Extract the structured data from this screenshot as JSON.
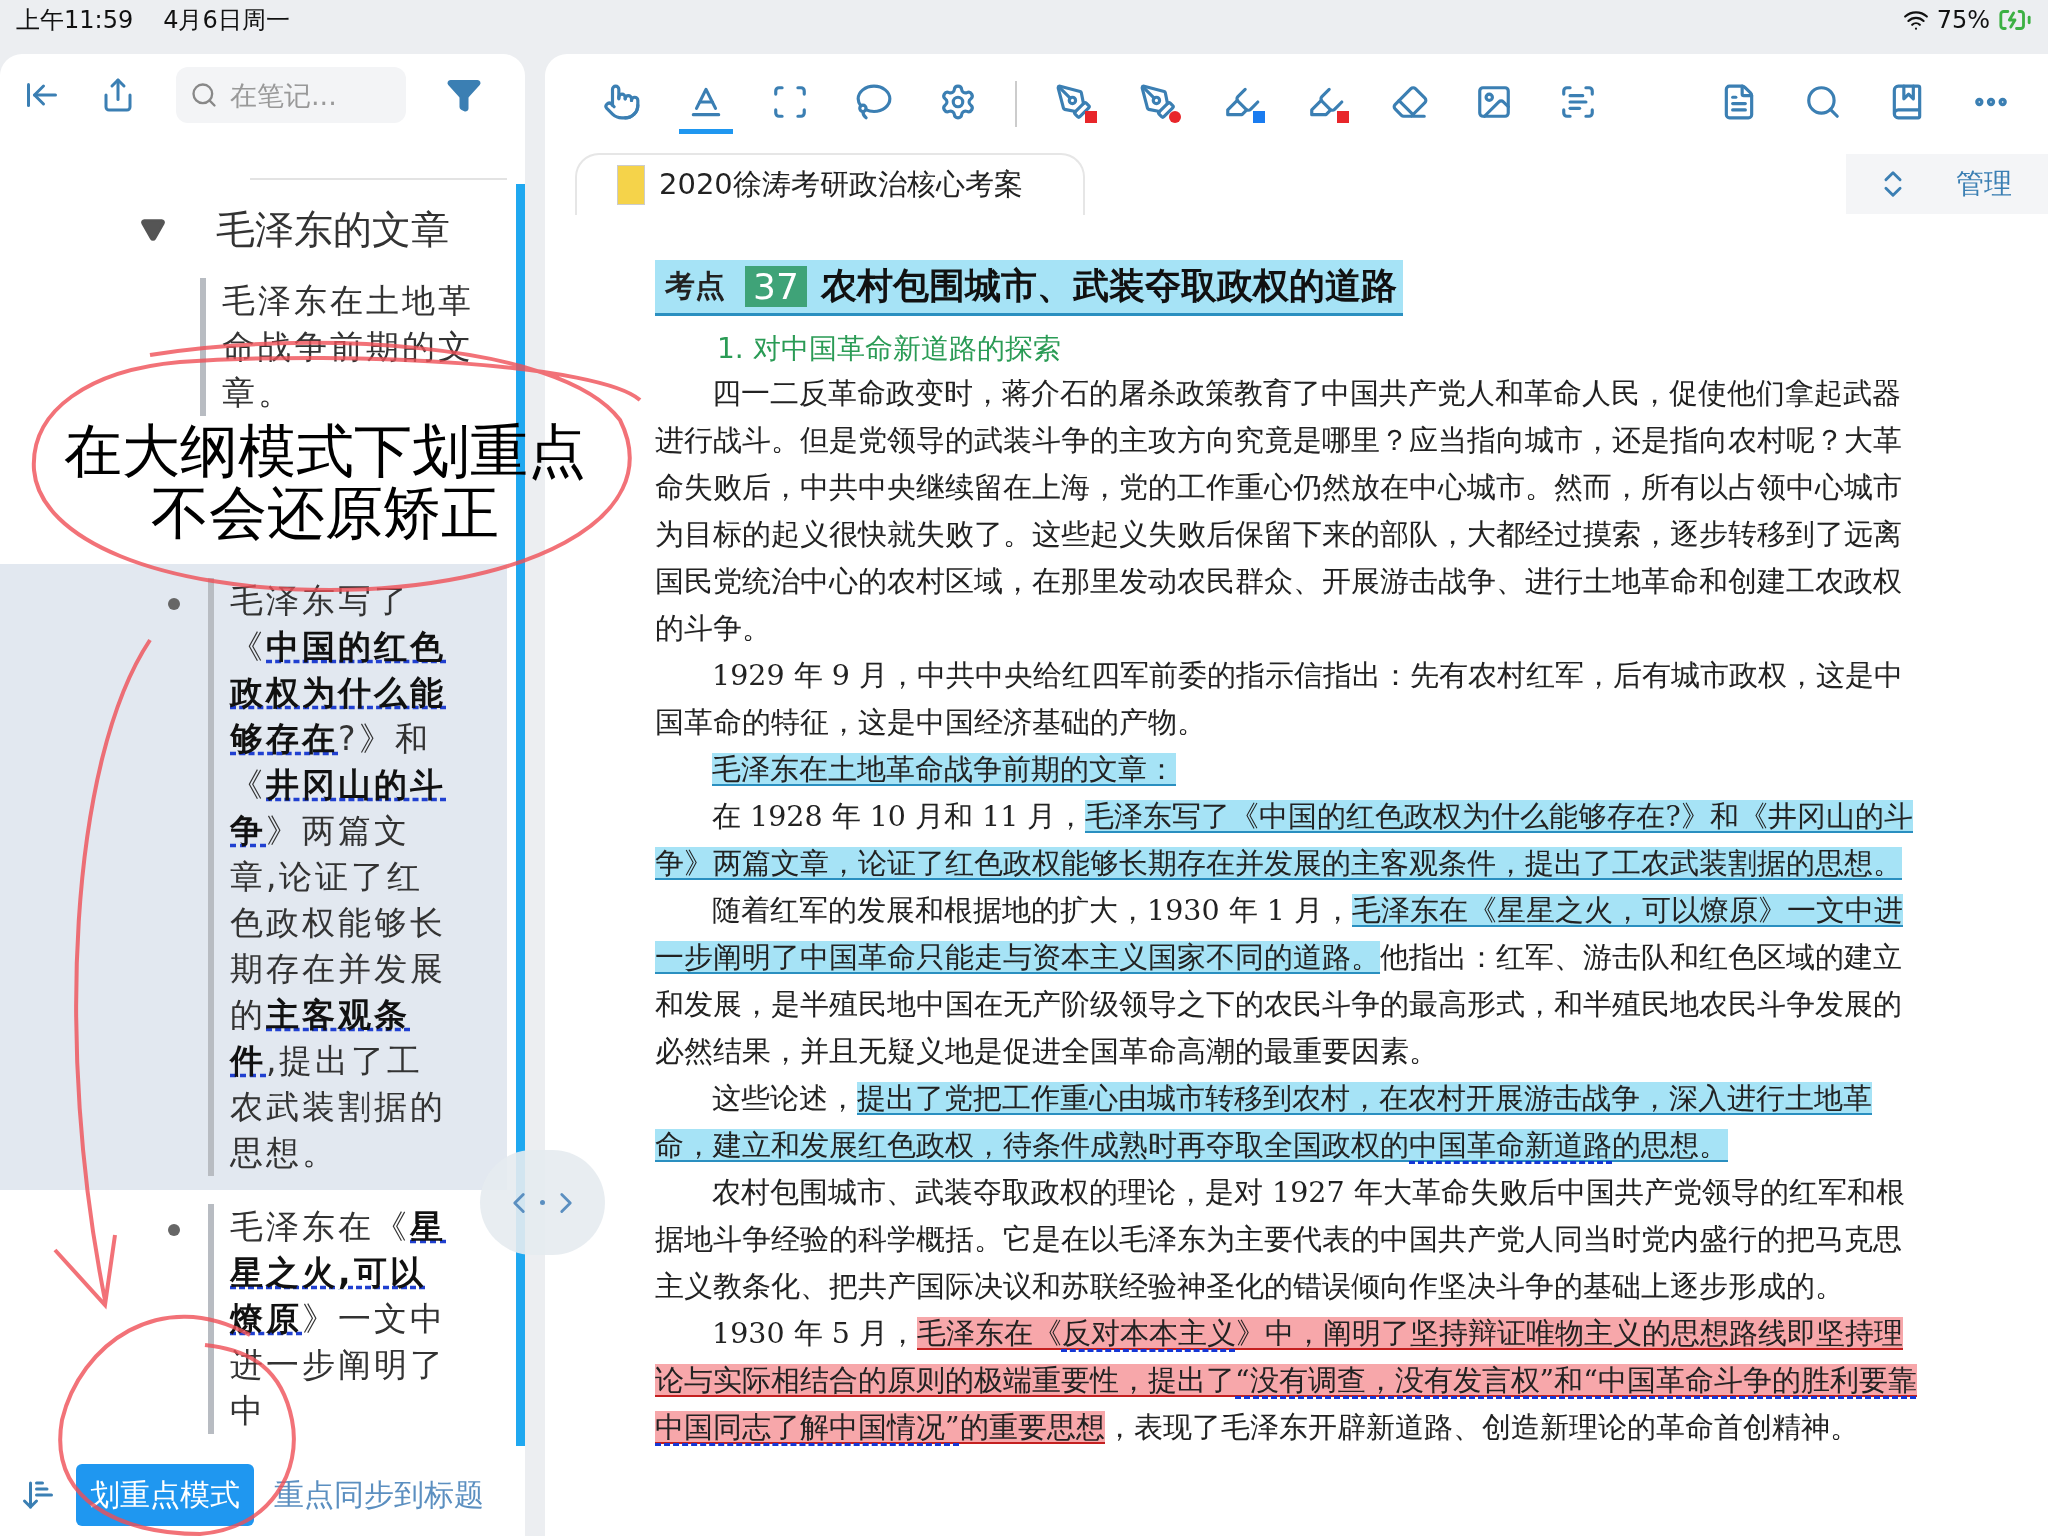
{
  "status_bar": {
    "time": "上午11:59",
    "date": "4月6日周一",
    "battery": "75%"
  },
  "outline_panel": {
    "search": {
      "placeholder": "在笔记..."
    },
    "outline": {
      "title": "毛泽东的文章",
      "expanded": true,
      "children": [
        {
          "text": "毛泽东在土地革命战争前期的文章。",
          "selected": false,
          "children": [
            {
              "text": "毛泽东写了《**中国的红色政权为什么能够存在**?》和《**井冈山的斗争**》两篇文章,论证了红色政权能够长期存在并发展的**主客观条件**,提出了工农武装割据的思想。",
              "selected": true
            },
            {
              "text": "毛泽东在《**星星之火,可以燎原**》一文中进一步阐明了中",
              "selected": false
            }
          ]
        }
      ]
    },
    "mode_button": {
      "label": "划重点模式",
      "on": true
    },
    "sync_link": "重点同步到标题"
  },
  "annotation": {
    "lines": [
      "在大纲模式下划重点",
      "不会还原矫正"
    ]
  },
  "document": {
    "tools": [
      {
        "kind": "hand",
        "selected": false
      },
      {
        "kind": "text-highlight",
        "selected": true
      },
      {
        "kind": "rect-select",
        "selected": false
      },
      {
        "kind": "lasso",
        "selected": false
      },
      {
        "kind": "settings",
        "selected": false
      }
    ],
    "pens": [
      {
        "kind": "pen-square",
        "color": "#e8262a"
      },
      {
        "kind": "pen-dot",
        "color": "#e8262a"
      },
      {
        "kind": "highlighter",
        "color": "#1a7cf0"
      },
      {
        "kind": "highlighter",
        "color": "#e8262a"
      }
    ],
    "utilities": [
      {
        "kind": "eraser"
      },
      {
        "kind": "image"
      },
      {
        "kind": "text-box"
      }
    ],
    "actions": [
      {
        "kind": "document"
      },
      {
        "kind": "search"
      },
      {
        "kind": "bookmark"
      },
      {
        "kind": "more"
      }
    ],
    "tab": {
      "title": "2020徐涛考研政治核心考案"
    },
    "manage_button": "管理",
    "page": {
      "heading": {
        "badge": "考点",
        "number": "37",
        "title": "农村包围城市、武装夺取政权的道路"
      },
      "subheading": "1. 对中国革命新道路的探索",
      "paragraphs": [
        {
          "segments": [
            {
              "text": "四一二反革命政变时，蒋介石的屠杀政策教育了中国共产党人和革命人民，促使他们拿起武器进行战斗。但是党领导的武装斗争的主攻方向究竟是哪里？应当指向城市，还是指向农村呢？大革命失败后，中共中央继续留在上海，党的工作重心仍然放在中心城市。然而，所有以占领中心城市为目标的起义很快就失败了。这些起义失败后保留下来的部队，大都经过摸索，逐步转移到了远离国民党统治中心的农村区域，在那里发动农民群众、开展游击战争、进行土地革命和创建工农政权的斗争。",
              "kind": "plain",
              "underlined": false
            }
          ]
        },
        {
          "segments": [
            {
              "text": "1929 年 9 月，中共中央给红四军前委的指示信指出：先有农村红军，后有城市政权，这是中国革命的特征，这是中国经济基础的产物。",
              "kind": "plain",
              "underlined": false
            }
          ]
        },
        {
          "segments": [
            {
              "text": "毛泽东在土地革命战争前期的文章：",
              "kind": "blue",
              "underlined": false
            }
          ]
        },
        {
          "segments": [
            {
              "text": "在 1928 年 10 月和 11 月，",
              "kind": "plain",
              "underlined": false
            },
            {
              "text": "毛泽东写了《中国的红色政权为什么能够存在?》和《井冈山的斗争》两篇文章，论证了红色政权能够长期存在并发展的主客观条件，提出了工农武装割据的思想。",
              "kind": "blue",
              "underlined": false
            }
          ]
        },
        {
          "segments": [
            {
              "text": "随着红军的发展和根据地的扩大，1930 年 1 月，",
              "kind": "plain",
              "underlined": false
            },
            {
              "text": "毛泽东在《星星之火，可以燎原》一文中进一步阐明了中国革命只能走与资本主义国家不同的道路。",
              "kind": "blue",
              "underlined": false
            },
            {
              "text": "他指出：红军、游击队和红色区域的建立和发展，是半殖民地中国在无产阶级领导之下的农民斗争的最高形式，和半殖民地农民斗争发展的必然结果，并且无疑义地是促进全国革命高潮的最重要因素。",
              "kind": "plain",
              "underlined": false
            }
          ]
        },
        {
          "segments": [
            {
              "text": "这些论述，",
              "kind": "plain",
              "underlined": false
            },
            {
              "text": "提出了党把工作重心由城市转移到农村，在农村开展游击战争，深入进行土地革命，建立和发展红色政权，待条件成熟时再夺取全国政权的",
              "kind": "blue",
              "underlined": false
            },
            {
              "text": "中国革命新道路",
              "kind": "blue",
              "underlined": true
            },
            {
              "text": "的思想。",
              "kind": "blue",
              "underlined": false
            }
          ]
        },
        {
          "segments": [
            {
              "text": "农村包围城市、武装夺取政权的理论，是对 1927 年大革命失败后中国共产党领导的红军和根据地斗争经验的科学概括。它是在以毛泽东为主要代表的中国共产党人同当时党内盛行的把马克思主义教条化、把共产国际决议和苏联经验神圣化的错误倾向作坚决斗争的基础上逐步形成的。",
              "kind": "plain",
              "underlined": false
            }
          ]
        },
        {
          "segments": [
            {
              "text": "1930 年 5 月，",
              "kind": "plain",
              "underlined": false
            },
            {
              "text": "毛泽东在《",
              "kind": "red",
              "underlined": false
            },
            {
              "text": "反对本本主义",
              "kind": "red",
              "underlined": true
            },
            {
              "text": "》中，阐明了坚持辩证唯物主义的思想路线即坚持理论与实际相结合的原则的极端重要性，提出了",
              "kind": "red",
              "underlined": false
            },
            {
              "text": "“没有调查，没有发言权”和“中国革命斗争的胜利要靠中国同志了解中国情况”",
              "kind": "red",
              "underlined": true
            },
            {
              "text": "的重要思想",
              "kind": "red",
              "underlined": false
            },
            {
              "text": "，表现了毛泽东开辟新道路、创造新理论的革命首创精神。",
              "kind": "plain",
              "underlined": false
            }
          ]
        }
      ]
    }
  }
}
